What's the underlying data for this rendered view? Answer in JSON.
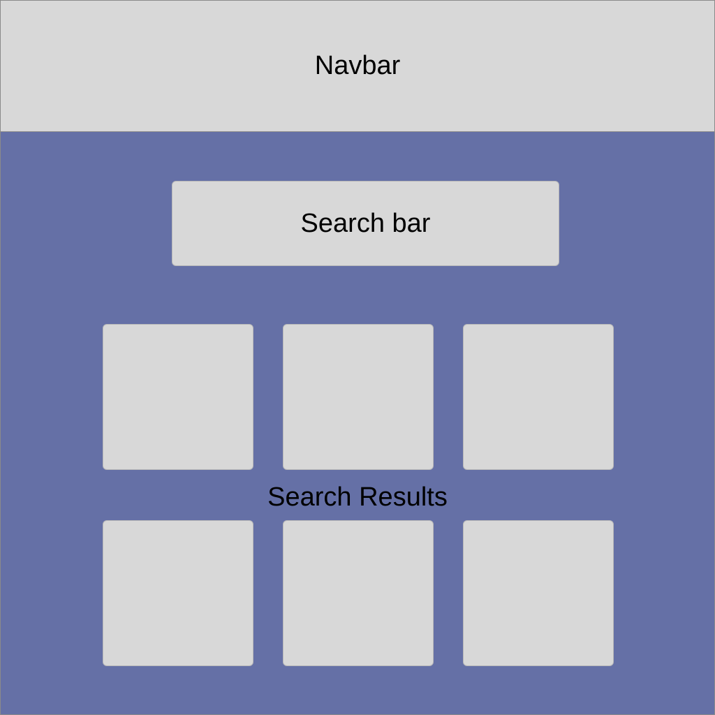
{
  "navbar": {
    "label": "Navbar"
  },
  "search": {
    "label": "Search bar"
  },
  "results": {
    "heading": "Search Results",
    "cards": [
      {},
      {},
      {},
      {},
      {},
      {}
    ]
  },
  "colors": {
    "content_background": "#6570a6",
    "box_fill": "#d8d8d8"
  }
}
